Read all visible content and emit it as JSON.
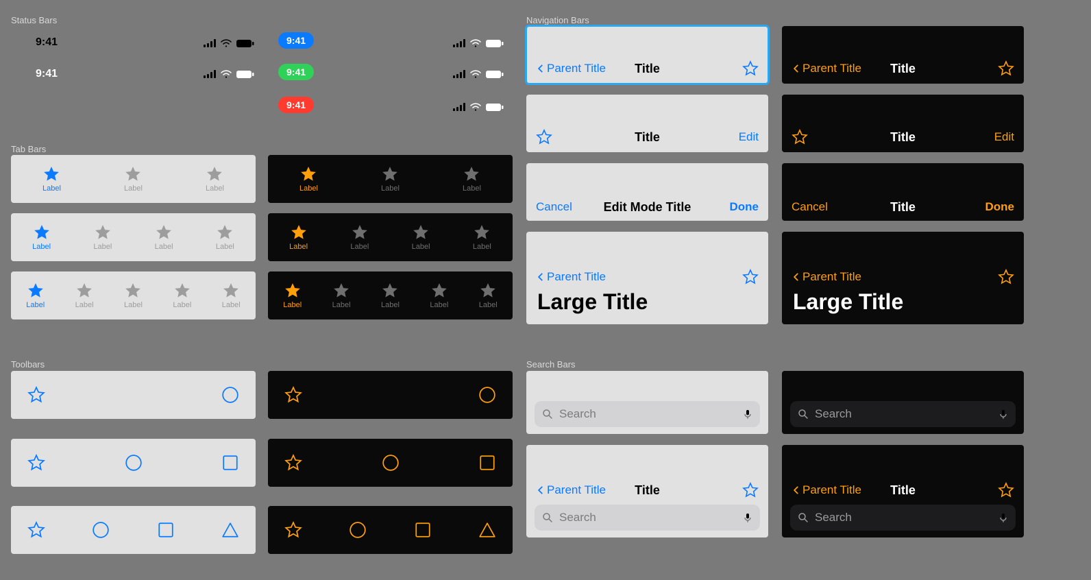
{
  "sections": {
    "status_bars": "Status Bars",
    "tab_bars": "Tab Bars",
    "toolbars": "Toolbars",
    "navigation_bars": "Navigation Bars",
    "search_bars": "Search Bars"
  },
  "status": {
    "time": "9:41",
    "pill_colors": {
      "blue": "#0a7aff",
      "green": "#30d158",
      "red": "#ff3b30"
    }
  },
  "tabs": {
    "label": "Label"
  },
  "nav": {
    "parent": "Parent Title",
    "title": "Title",
    "edit": "Edit",
    "cancel": "Cancel",
    "done": "Done",
    "edit_mode_title": "Edit Mode Title",
    "large_title": "Large Title"
  },
  "search": {
    "placeholder": "Search"
  },
  "colors": {
    "ios_blue": "#0a7aff",
    "ios_orange": "#ff9f0a",
    "light_bg": "#e1e1e1",
    "dark_bg": "#0a0a0a",
    "canvas": "#7a7a7a",
    "search_light": "#d3d3d5",
    "search_dark": "#1c1c1e"
  }
}
